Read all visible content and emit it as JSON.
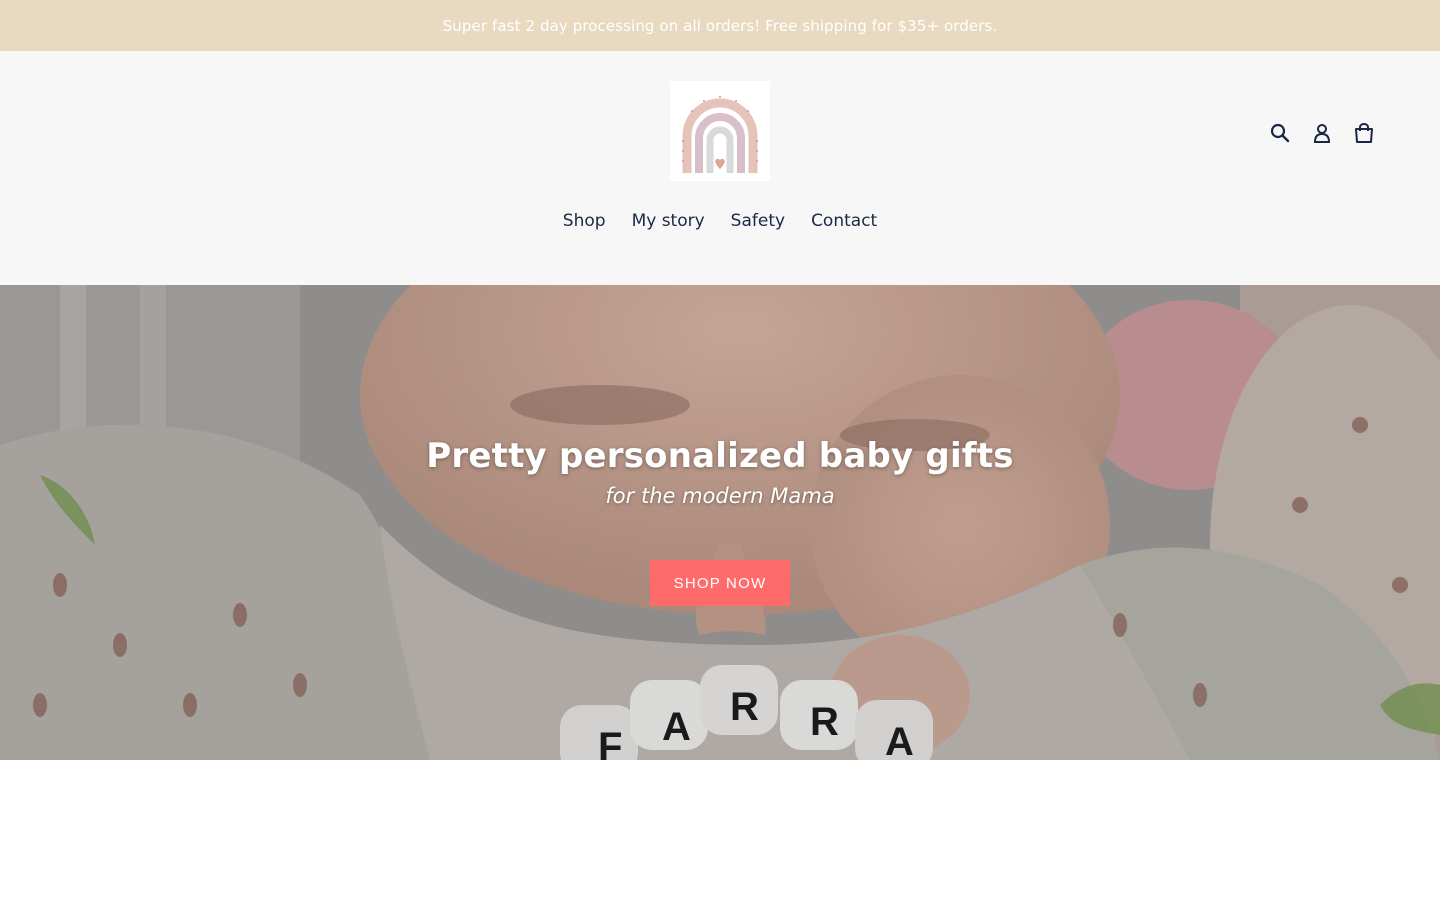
{
  "announcement": {
    "text": "Super fast 2 day processing on all orders! Free shipping for $35+ orders."
  },
  "header": {
    "logo_icon": "rainbow-logo",
    "icons": [
      "search-icon",
      "account-icon",
      "cart-icon"
    ],
    "nav": [
      {
        "label": "Shop"
      },
      {
        "label": "My story"
      },
      {
        "label": "Safety"
      },
      {
        "label": "Contact"
      }
    ]
  },
  "hero": {
    "title": "Pretty personalized baby gifts",
    "subtitle": "for the modern Mama",
    "cta_label": "SHOP NOW",
    "image_subject": "baby with personalized teether",
    "bead_letters": [
      "F",
      "A",
      "R",
      "R",
      "A"
    ]
  },
  "colors": {
    "announcement_bg": "#e8d9c0",
    "header_bg": "#f7f7f7",
    "nav_text": "#1b2845",
    "cta_bg": "#ff6b6b",
    "logo_rainbow": "#e6c8c0"
  }
}
